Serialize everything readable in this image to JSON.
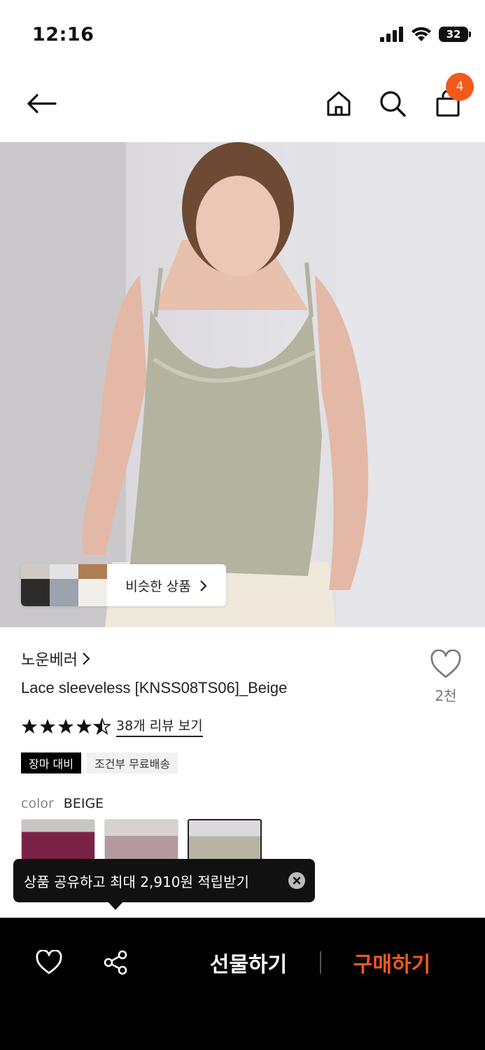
{
  "status_bar": {
    "time": "12:16",
    "battery": "32"
  },
  "nav": {
    "cart_count": "4"
  },
  "similar": {
    "label": "비슷한 상품"
  },
  "product": {
    "brand": "노운베러",
    "name": "Lace sleeveless [KNSS08TS06]_Beige",
    "like_count": "2천",
    "review_link": "38개 리뷰 보기",
    "rating": 4.5,
    "tags": [
      "장마 대비",
      "조건부 무료배송"
    ],
    "color_label": "color",
    "color_value": "BEIGE"
  },
  "tooltip": {
    "text": "상품 공유하고 최대 2,910원 적립받기"
  },
  "bottom_bar": {
    "gift_label": "선물하기",
    "buy_label": "구매하기"
  },
  "colors": {
    "accent": "#f25a1c",
    "dark": "#000000"
  },
  "icons": [
    "back-arrow-icon",
    "home-icon",
    "search-icon",
    "cart-icon",
    "heart-icon",
    "share-icon",
    "close-icon",
    "chevron-right-icon",
    "star-icon"
  ]
}
